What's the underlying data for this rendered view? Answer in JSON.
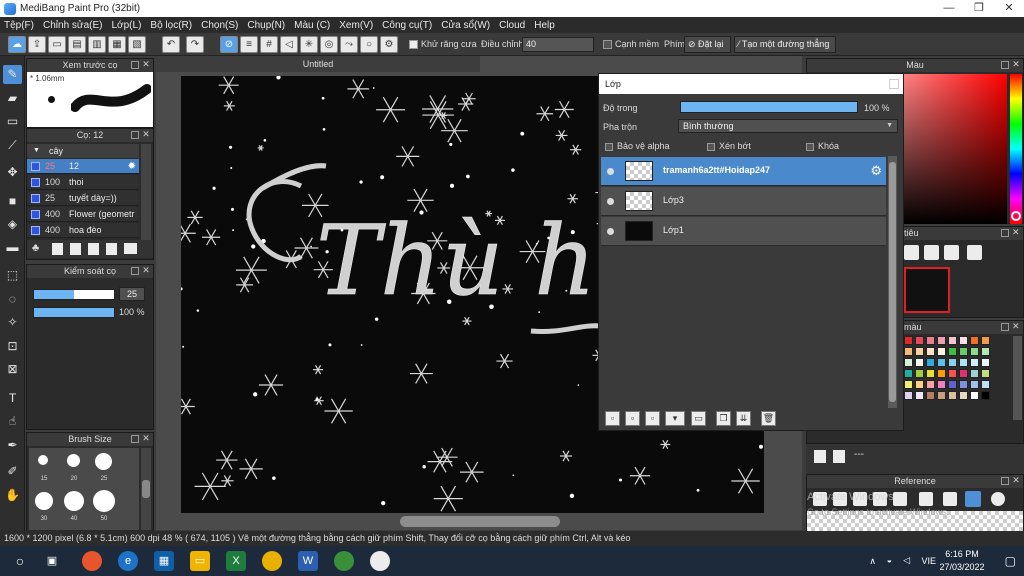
{
  "window": {
    "title": "MediBang Paint Pro (32bit)",
    "controls": [
      "—",
      "❐",
      "✕"
    ]
  },
  "menu": [
    "Tệp(F)",
    "Chỉnh sửa(E)",
    "Lớp(L)",
    "Bộ lọc(R)",
    "Chọn(S)",
    "Chụp(N)",
    "Màu (C)",
    "Xem(V)",
    "Công cụ(T)",
    "Cửa sổ(W)",
    "Cloud",
    "Help"
  ],
  "toolbar": {
    "antialias_label": "Khử răng cưa",
    "adjust_label": "Điều chỉnh",
    "adjust_value": "40",
    "edge_label": "Cạnh mềm",
    "key_label": "Phím",
    "reset_label": "Đặt lại",
    "make_line_label": "Tạo một đường thẳng"
  },
  "brush_preview": {
    "title": "Xem trước cọ",
    "size": "1.06mm"
  },
  "brush_panel": {
    "title": "Cọ: 12",
    "group": "cây",
    "items": [
      {
        "size": "25",
        "name": "12",
        "selected": true
      },
      {
        "size": "100",
        "name": "thoi",
        "selected": false
      },
      {
        "size": "25",
        "name": "tuyết dày=))",
        "selected": false
      },
      {
        "size": "400",
        "name": "Flower (geometr",
        "selected": false
      },
      {
        "size": "400",
        "name": "hoa đèo",
        "selected": false
      }
    ]
  },
  "control_panel": {
    "title": "Kiểm soát cọ",
    "size_value": "25",
    "opacity_value": "100 %",
    "size_fraction": 0.5,
    "opacity_fraction": 1.0
  },
  "size_panel": {
    "title": "Brush Size",
    "sizes": [
      "15",
      "20",
      "25",
      "30",
      "40",
      "50"
    ]
  },
  "canvas": {
    "tab_title": "Untitled",
    "text": "Thù hận"
  },
  "color_panel": {
    "title": "Màu"
  },
  "nav_panel": {
    "title": "tiêu"
  },
  "palette_panel": {
    "title": "màu"
  },
  "palette_colors": [
    "#e0282a",
    "#e64a5a",
    "#e87f8a",
    "#ef9fb0",
    "#f5c3cf",
    "#fbe0e6",
    "#f07020",
    "#f29a4a",
    "#f6b877",
    "#f8cfa0",
    "#fbe4c6",
    "#fdf1e0",
    "#3fbf3f",
    "#66cc66",
    "#8fd98f",
    "#b3e6b3",
    "#d6f2d6",
    "#eefaee",
    "#2fa9e0",
    "#5bbfe8",
    "#88d2ef",
    "#b1e2f5",
    "#d2eefa",
    "#ecf8fd",
    "#20b0a0",
    "#a0d040",
    "#e8e030",
    "#ff9a00",
    "#ff5050",
    "#e03070",
    "#a0d0d0",
    "#c0e080",
    "#f0f070",
    "#ffd080",
    "#ffa0a0",
    "#f080c0",
    "#6060d0",
    "#8090e0",
    "#a0c0f0",
    "#c0e0f8",
    "#e0d0f0",
    "#f0e8f8",
    "#b08060",
    "#c8a080",
    "#d8c0a0",
    "#e8d8c0",
    "#ffffff",
    "#000000"
  ],
  "reference_panel": {
    "title": "Reference"
  },
  "activate_watermark": {
    "line1": "Activate Windows",
    "line2": "Go to Settings to activate Windows."
  },
  "layer_window": {
    "title": "Lớp",
    "opacity_label": "Độ trong",
    "opacity_value": "100 %",
    "opacity_fraction": 1.0,
    "blend_label": "Pha trộn",
    "blend_value": "Bình thường",
    "protect_alpha": "Bảo vệ alpha",
    "clipping": "Xén bớt",
    "lock": "Khóa",
    "layers": [
      {
        "name": "tramanh6a2tt#Hoidap247",
        "selected": true,
        "thumb": "trans"
      },
      {
        "name": "Lớp3",
        "selected": false,
        "thumb": "trans"
      },
      {
        "name": "Lớp1",
        "selected": false,
        "thumb": "dark"
      }
    ]
  },
  "status": "1600 * 1200 pixel  (6.8 * 5.1cm)  600 dpi  48 %  ( 674, 1105 )  Vẽ một đường thẳng bằng cách giữ phím Shift, Thay đổi cỡ cọ bằng cách giữ phím Ctrl, Alt và kéo",
  "taskbar": {
    "lang": "VIE",
    "time": "6:16 PM",
    "date": "27/03/2022"
  }
}
